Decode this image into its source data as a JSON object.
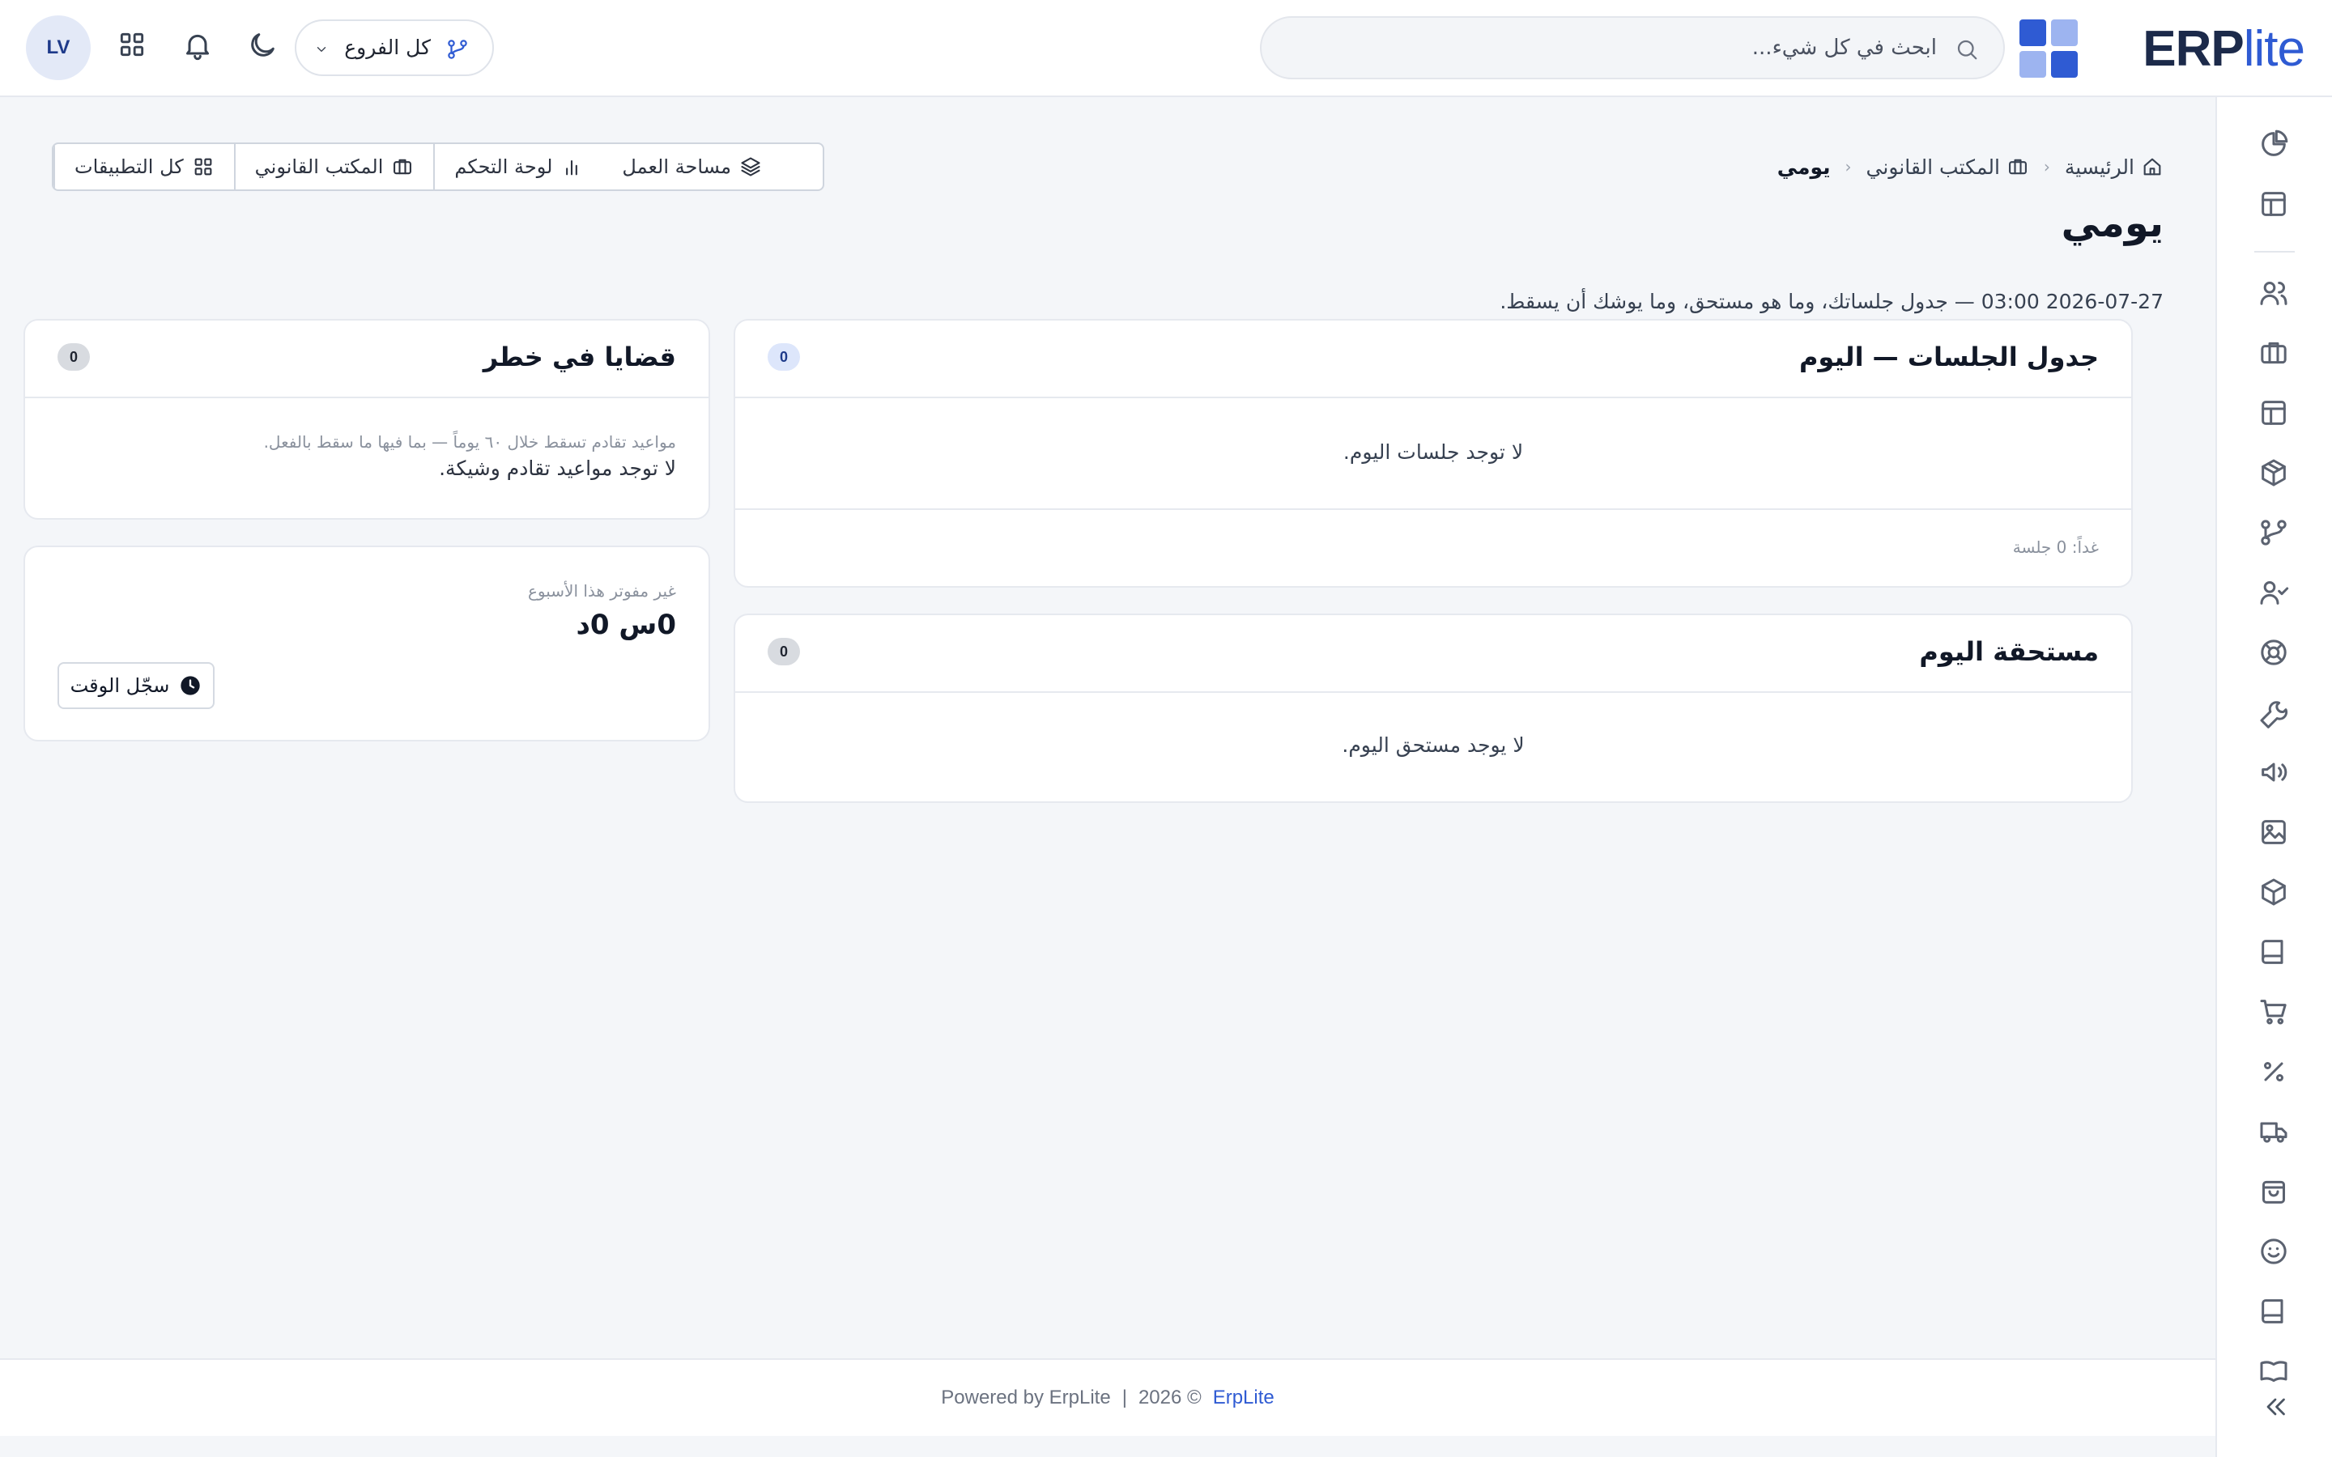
{
  "header": {
    "logo_erp": "ERP",
    "logo_lite": "lite",
    "search_placeholder": "ابحث في كل شيء...",
    "branch_label": "كل الفروع",
    "avatar_initials": "LV"
  },
  "breadcrumb": {
    "home": "الرئيسية",
    "section": "المكتب القانوني",
    "current": "يومي"
  },
  "actions": {
    "all_apps": "كل التطبيقات",
    "legal_office": "المكتب القانوني",
    "dashboard": "لوحة التحكم",
    "workspace": "مساحة العمل"
  },
  "page": {
    "title": "يومي",
    "subtitle": "2026-07-27 03:00 — جدول جلساتك، وما هو مستحق، وما يوشك أن يسقط."
  },
  "cards": {
    "sessions": {
      "title": "جدول الجلسات — اليوم",
      "count": "0",
      "empty": "لا توجد جلسات اليوم.",
      "tomorrow": "غداً: 0 جلسة"
    },
    "due": {
      "title": "مستحقة اليوم",
      "count": "0",
      "empty": "لا يوجد مستحق اليوم."
    },
    "risk": {
      "title": "قضايا في خطر",
      "count": "0",
      "note": "مواعيد تقادم تسقط خلال ٦٠ يوماً — بما فيها ما سقط بالفعل.",
      "empty": "لا توجد مواعيد تقادم وشيكة."
    },
    "time": {
      "label": "غير مفوتر هذا الأسبوع",
      "value": "0س 0د",
      "button": "سجّل الوقت"
    }
  },
  "footer": {
    "powered": "Powered by ErpLite",
    "divider": "|",
    "copyright": "2026 ©",
    "brand": "ErpLite"
  },
  "sidebar_icons": [
    "pie-chart-icon",
    "layout-icon",
    "users-icon",
    "briefcase-icon",
    "layout-icon",
    "box-icon",
    "git-branch-icon",
    "user-check-icon",
    "life-buoy-icon",
    "wrench-icon",
    "megaphone-icon",
    "image-icon",
    "cube-icon",
    "book-icon",
    "cart-icon",
    "percent-icon",
    "truck-icon",
    "shopping-bag-icon",
    "smile-icon",
    "book-icon"
  ],
  "colors": {
    "accent": "#2f5bd3",
    "logo_dark": "#1c2a4a",
    "background": "#f4f6f9"
  }
}
